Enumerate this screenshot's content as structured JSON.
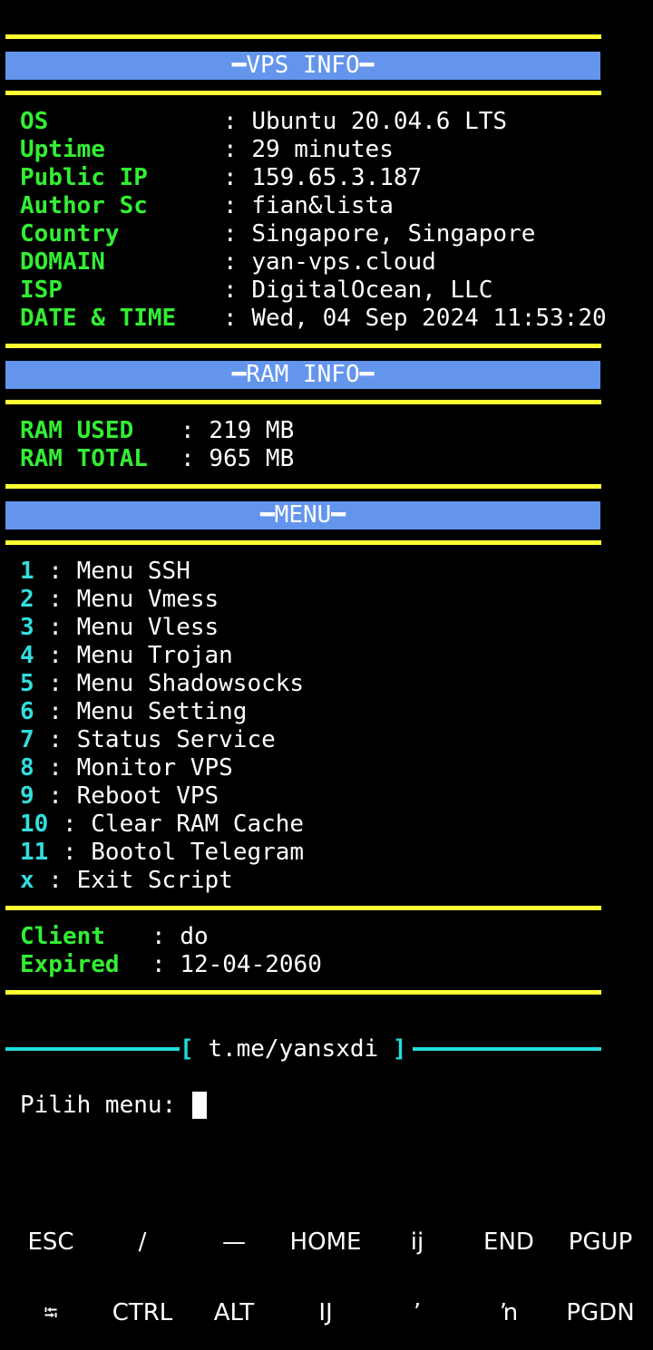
{
  "vps": {
    "title": "━VPS INFO━",
    "rows": [
      {
        "label": "OS",
        "value": "Ubuntu 20.04.6 LTS"
      },
      {
        "label": "Uptime",
        "value": "29 minutes"
      },
      {
        "label": "Public IP",
        "value": "159.65.3.187"
      },
      {
        "label": "Author Sc",
        "value": "fian&lista"
      },
      {
        "label": "Country",
        "value": "Singapore, Singapore"
      },
      {
        "label": "DOMAIN",
        "value": "yan-vps.cloud"
      },
      {
        "label": "ISP",
        "value": "DigitalOcean, LLC"
      },
      {
        "label": "DATE & TIME",
        "value": "Wed, 04 Sep 2024 11:53:20"
      }
    ]
  },
  "ram": {
    "title": "━RAM INFO━",
    "rows": [
      {
        "label": "RAM USED",
        "value": "219 MB"
      },
      {
        "label": "RAM TOTAL",
        "value": "965 MB"
      }
    ]
  },
  "menu": {
    "title": "━MENU━",
    "items": [
      {
        "key": "1",
        "label": "Menu SSH"
      },
      {
        "key": "2",
        "label": "Menu Vmess"
      },
      {
        "key": "3",
        "label": "Menu Vless"
      },
      {
        "key": "4",
        "label": "Menu Trojan"
      },
      {
        "key": "5",
        "label": "Menu Shadowsocks"
      },
      {
        "key": "6",
        "label": "Menu Setting"
      },
      {
        "key": "7",
        "label": "Status Service"
      },
      {
        "key": "8",
        "label": "Monitor VPS"
      },
      {
        "key": "9",
        "label": "Reboot VPS"
      },
      {
        "key": "10",
        "label": "Clear RAM Cache"
      },
      {
        "key": "11",
        "label": "Bootol Telegram"
      },
      {
        "key": "x",
        "label": "Exit Script"
      }
    ]
  },
  "client": {
    "rows": [
      {
        "label": "Client",
        "value": "do"
      },
      {
        "label": "Expired",
        "value": "12-04-2060"
      }
    ]
  },
  "telegram": {
    "open": "[",
    "link": "t.me/yansxdi",
    "close": "]"
  },
  "prompt": {
    "text": "Pilih menu:",
    "input_value": ""
  },
  "extra_keys": {
    "row1": [
      "ESC",
      "/",
      "—",
      "HOME",
      "ij",
      "END",
      "PGUP"
    ],
    "row2": [
      "⭾",
      "CTRL",
      "ALT",
      "Ĳ",
      "ʼ",
      "ŉ",
      "PGDN"
    ]
  },
  "colors": {
    "background": "#000000",
    "rule_yellow": "#ffff33",
    "banner_blue": "#6495ed",
    "label_green": "#33ee33",
    "accent_cyan": "#22dddd",
    "text_white": "#ffffff"
  }
}
